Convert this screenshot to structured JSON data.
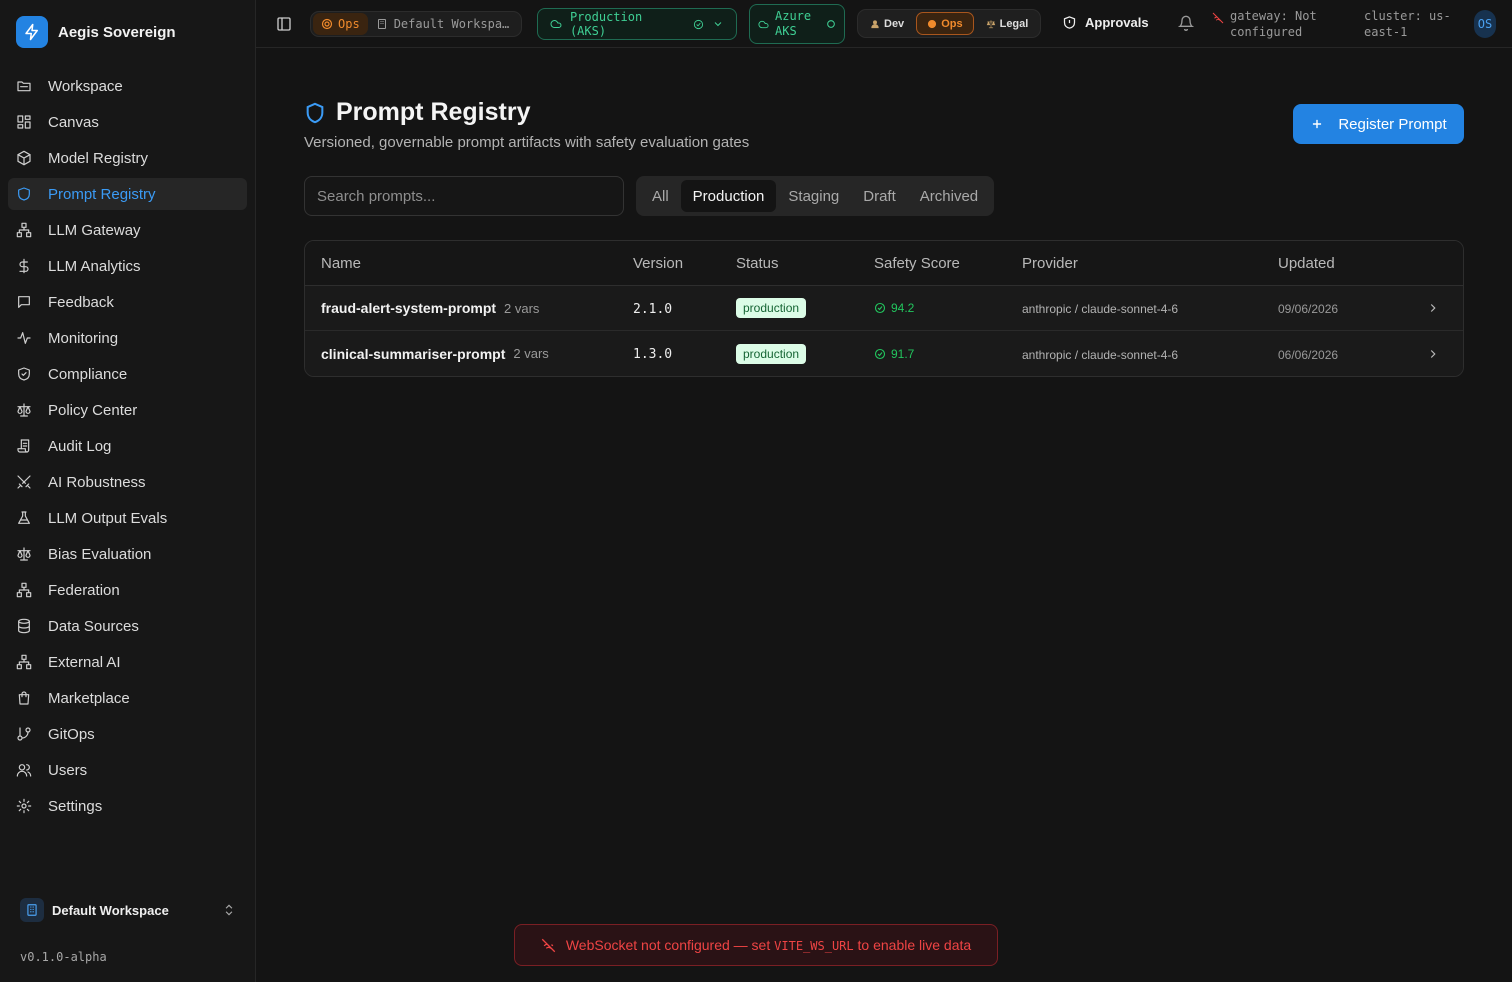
{
  "app": {
    "name": "Aegis Sovereign",
    "version": "v0.1.0-alpha"
  },
  "sidebar": {
    "items": [
      {
        "label": "Workspace",
        "icon": "folder-icon"
      },
      {
        "label": "Canvas",
        "icon": "grid-icon"
      },
      {
        "label": "Model Registry",
        "icon": "cube-icon"
      },
      {
        "label": "Prompt Registry",
        "icon": "shield-icon",
        "active": true
      },
      {
        "label": "LLM Gateway",
        "icon": "network-icon"
      },
      {
        "label": "LLM Analytics",
        "icon": "dollar-icon"
      },
      {
        "label": "Feedback",
        "icon": "message-icon"
      },
      {
        "label": "Monitoring",
        "icon": "activity-icon"
      },
      {
        "label": "Compliance",
        "icon": "shield-check-icon"
      },
      {
        "label": "Policy Center",
        "icon": "scale-icon"
      },
      {
        "label": "Audit Log",
        "icon": "scroll-icon"
      },
      {
        "label": "AI Robustness",
        "icon": "swords-icon"
      },
      {
        "label": "LLM Output Evals",
        "icon": "flask-icon"
      },
      {
        "label": "Bias Evaluation",
        "icon": "scale-icon"
      },
      {
        "label": "Federation",
        "icon": "network-icon"
      },
      {
        "label": "Data Sources",
        "icon": "database-icon"
      },
      {
        "label": "External AI",
        "icon": "network-icon"
      },
      {
        "label": "Marketplace",
        "icon": "shopping-bag-icon"
      },
      {
        "label": "GitOps",
        "icon": "git-branch-icon"
      },
      {
        "label": "Users",
        "icon": "users-icon"
      },
      {
        "label": "Settings",
        "icon": "gear-icon"
      }
    ],
    "workspace": "Default Workspace"
  },
  "topbar": {
    "role_badge": "Ops",
    "workspace_badge": "Default Workspa…",
    "environment": "Production (AKS)",
    "cloud_line1": "Azure",
    "cloud_line2": "AKS",
    "roles": [
      {
        "label": "Dev"
      },
      {
        "label": "Ops",
        "active": true
      },
      {
        "label": "Legal"
      }
    ],
    "approvals": "Approvals",
    "gateway_line1": "gateway: Not",
    "gateway_line2": "configured",
    "cluster_line1": "cluster: us-",
    "cluster_line2": "east-1",
    "avatar": "OS"
  },
  "page": {
    "title": "Prompt Registry",
    "subtitle": "Versioned, governable prompt artifacts with safety evaluation gates",
    "register_label": "Register Prompt",
    "search_placeholder": "Search prompts...",
    "tabs": [
      {
        "label": "All"
      },
      {
        "label": "Production",
        "active": true
      },
      {
        "label": "Staging"
      },
      {
        "label": "Draft"
      },
      {
        "label": "Archived"
      }
    ]
  },
  "table": {
    "headers": {
      "name": "Name",
      "version": "Version",
      "status": "Status",
      "safety": "Safety Score",
      "provider": "Provider",
      "updated": "Updated"
    },
    "rows": [
      {
        "name": "fraud-alert-system-prompt",
        "vars": "2 vars",
        "version": "2.1.0",
        "status": "production",
        "safety": "94.2",
        "provider": "anthropic / claude-sonnet-4-6",
        "updated": "09/06/2026"
      },
      {
        "name": "clinical-summariser-prompt",
        "vars": "2 vars",
        "version": "1.3.0",
        "status": "production",
        "safety": "91.7",
        "provider": "anthropic / claude-sonnet-4-6",
        "updated": "06/06/2026"
      }
    ]
  },
  "toast": {
    "before": "WebSocket not configured — set",
    "code": "VITE_WS_URL",
    "after": "to enable live data"
  },
  "colors": {
    "accent": "#2383e2",
    "active_nav": "#3b9bf5",
    "ops": "#f08a2c",
    "env": "#3fcf94",
    "success": "#22c55e",
    "error": "#ef4444"
  }
}
